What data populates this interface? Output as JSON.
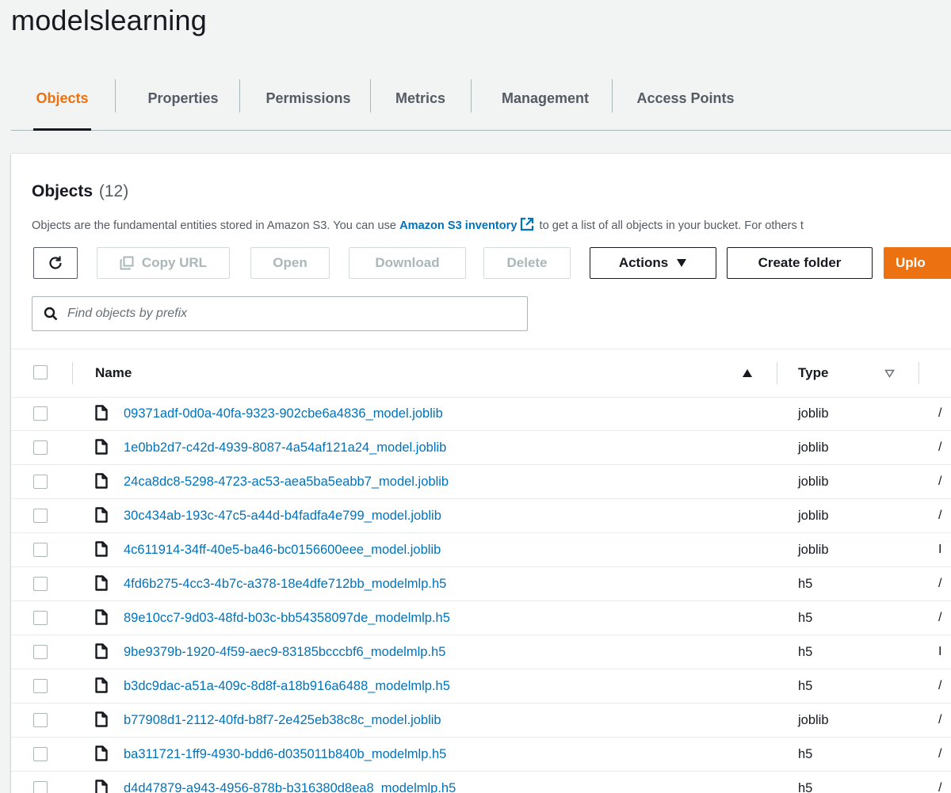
{
  "bucket": {
    "title": "modelslearning"
  },
  "tabs": [
    {
      "label": "Objects",
      "active": true
    },
    {
      "label": "Properties",
      "active": false
    },
    {
      "label": "Permissions",
      "active": false
    },
    {
      "label": "Metrics",
      "active": false
    },
    {
      "label": "Management",
      "active": false
    },
    {
      "label": "Access Points",
      "active": false
    }
  ],
  "objects": {
    "heading": "Objects",
    "count": "(12)",
    "description_before": "Objects are the fundamental entities stored in Amazon S3. You can use ",
    "description_link": "Amazon S3 inventory",
    "description_after": " to get a list of all objects in your bucket. For others t"
  },
  "toolbar": {
    "refresh_icon": "refresh-icon",
    "copy_url": "Copy URL",
    "open": "Open",
    "download": "Download",
    "delete": "Delete",
    "actions": "Actions",
    "create_folder": "Create folder",
    "upload": "Uplo"
  },
  "search": {
    "placeholder": "Find objects by prefix",
    "value": ""
  },
  "table": {
    "headers": {
      "name": "Name",
      "type": "Type"
    },
    "sort": {
      "column": "Name",
      "direction": "ascending"
    },
    "rows": [
      {
        "name": "09371adf-0d0a-40fa-9323-902cbe6a4836_model.joblib",
        "type": "joblib",
        "edge": "/"
      },
      {
        "name": "1e0bb2d7-c42d-4939-8087-4a54af121a24_model.joblib",
        "type": "joblib",
        "edge": "/"
      },
      {
        "name": "24ca8dc8-5298-4723-ac53-aea5ba5eabb7_model.joblib",
        "type": "joblib",
        "edge": "/"
      },
      {
        "name": "30c434ab-193c-47c5-a44d-b4fadfa4e799_model.joblib",
        "type": "joblib",
        "edge": "/"
      },
      {
        "name": "4c611914-34ff-40e5-ba46-bc0156600eee_model.joblib",
        "type": "joblib",
        "edge": "I"
      },
      {
        "name": "4fd6b275-4cc3-4b7c-a378-18e4dfe712bb_modelmlp.h5",
        "type": "h5",
        "edge": "/"
      },
      {
        "name": "89e10cc7-9d03-48fd-b03c-bb54358097de_modelmlp.h5",
        "type": "h5",
        "edge": "/"
      },
      {
        "name": "9be9379b-1920-4f59-aec9-83185bcccbf6_modelmlp.h5",
        "type": "h5",
        "edge": "I"
      },
      {
        "name": "b3dc9dac-a51a-409c-8d8f-a18b916a6488_modelmlp.h5",
        "type": "h5",
        "edge": "/"
      },
      {
        "name": "b77908d1-2112-40fd-b8f7-2e425eb38c8c_model.joblib",
        "type": "joblib",
        "edge": "/"
      },
      {
        "name": "ba311721-1ff9-4930-bdd6-d035011b840b_modelmlp.h5",
        "type": "h5",
        "edge": "/"
      },
      {
        "name": "d4d47879-a943-4956-878b-b316380d8ea8_modelmlp.h5",
        "type": "h5",
        "edge": "/"
      }
    ]
  },
  "colors": {
    "accent": "#ec7211",
    "link": "#0073bb",
    "text": "#16191f",
    "muted": "#545b64",
    "disabled": "#aab7b8"
  }
}
